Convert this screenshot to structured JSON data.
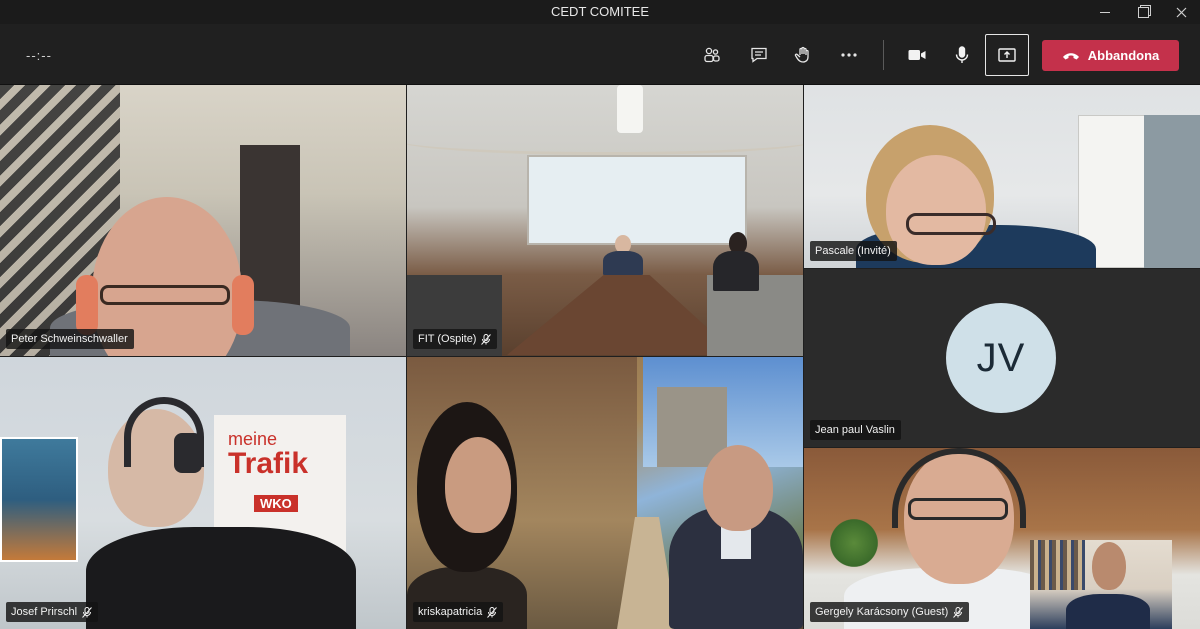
{
  "window": {
    "title": "CEDT COMITEE"
  },
  "toolbar": {
    "timer": "--:--",
    "leave_label": "Abbandona"
  },
  "participants": [
    {
      "name": "Peter Schweinschwaller",
      "muted": false
    },
    {
      "name": "FIT (Ospite)",
      "muted": true
    },
    {
      "name": "Pascale (Invité)",
      "muted": false
    },
    {
      "name": "Jean paul Vaslin",
      "initials": "JV",
      "muted": false
    },
    {
      "name": "Josef Prirschl",
      "muted": true
    },
    {
      "name": "kriskapatricia",
      "muted": true
    },
    {
      "name": "Gergely Karácsony (Guest)",
      "muted": true
    }
  ],
  "poster": {
    "line1": "meine",
    "line2": "Trafik",
    "badge": "WKO"
  },
  "colors": {
    "leave": "#c4314b",
    "avatar_bg": "#cfe0e8",
    "toolbar": "#202020"
  },
  "icons": [
    "participants-icon",
    "chat-icon",
    "raise-hand-icon",
    "more-icon",
    "camera-icon",
    "microphone-icon",
    "share-screen-icon",
    "hang-up-icon",
    "mic-off-icon"
  ]
}
